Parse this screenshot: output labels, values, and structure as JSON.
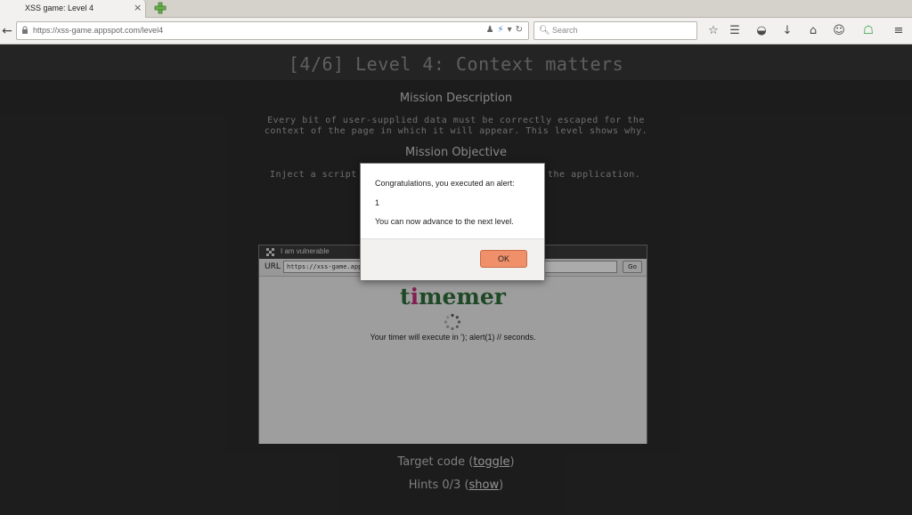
{
  "browser": {
    "tab_title": "XSS game: Level 4",
    "close_glyph": "×",
    "url": "https://xss-game.appspot.com/level4",
    "search_placeholder": "Search"
  },
  "page": {
    "title": "[4/6]  Level 4: Context matters",
    "mission_description_heading": "Mission Description",
    "mission_description_text": "Every bit of user-supplied data must be correctly escaped for the\ncontext of the page in which it will appear. This level shows why.",
    "mission_objective_heading": "Mission Objective",
    "mission_objective_left": "Inject a script",
    "mission_objective_right": "the application."
  },
  "frame": {
    "title": "I am vulnerable",
    "url_label": "URL",
    "url_value": "https://xss-game.appspot.com/level4/frame?timer=');+alert(1)+//",
    "go_label": "Go",
    "logo_pre": "t",
    "logo_pink": "i",
    "logo_post": "memer",
    "timer_message": "Your timer will execute in '); alert(1) // seconds."
  },
  "footer": {
    "target_code_text": "Target code (",
    "target_code_link": "toggle",
    "target_code_close": ")",
    "hints_text": "Hints 0/3 (",
    "hints_link": "show",
    "hints_close": ")"
  },
  "dialog": {
    "line1": "Congratulations, you executed an alert:",
    "line2": "1",
    "line3": "You can now advance to the next level.",
    "ok_label": "OK"
  },
  "colors": {
    "page_bg": "#2b2b2c",
    "ok_button": "#f0906a",
    "logo_green": "#2f6d3a",
    "logo_pink": "#c0307a"
  }
}
